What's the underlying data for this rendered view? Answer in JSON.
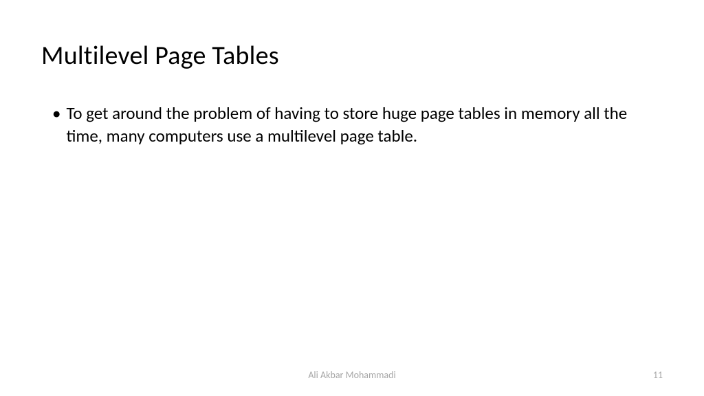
{
  "slide": {
    "title": "Multilevel Page Tables",
    "bullets": [
      {
        "text": "To get around the problem of having to store huge page tables in memory all the time, many computers use a multilevel page table."
      }
    ]
  },
  "footer": {
    "author": "Ali Akbar Mohammadi",
    "page_number": "11"
  }
}
